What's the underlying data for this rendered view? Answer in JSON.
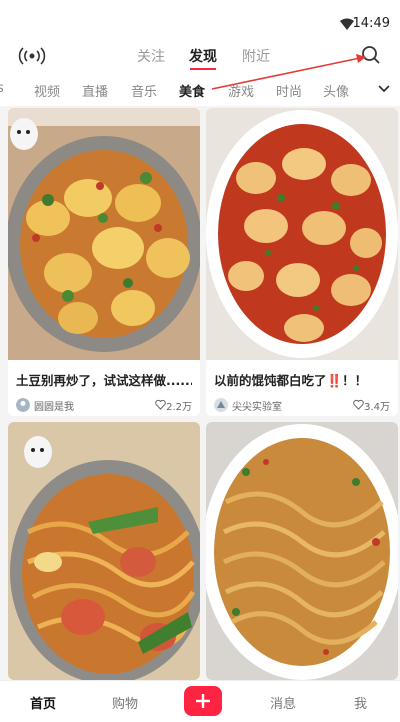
{
  "status_bar": {
    "time": "14:49",
    "wifi_icon": "wifi-icon"
  },
  "top_nav": {
    "live_icon": "live-broadcast-icon",
    "tabs": [
      {
        "label": "关注"
      },
      {
        "label": "发现"
      },
      {
        "label": "附近"
      }
    ],
    "active_tab": "发现",
    "search_icon": "search-icon"
  },
  "categories": {
    "items": [
      {
        "label": "视频"
      },
      {
        "label": "直播"
      },
      {
        "label": "音乐"
      },
      {
        "label": "美食"
      },
      {
        "label": "游戏"
      },
      {
        "label": "时尚"
      },
      {
        "label": "头像"
      }
    ],
    "active": "美食",
    "more_icon": "chevron-down-icon"
  },
  "feed": {
    "cards": [
      {
        "title": "土豆别再炒了，试试这样做......",
        "author": "圆圆是我",
        "likes": "2.2万",
        "image": "potato-dish-photo"
      },
      {
        "title": "以前的馄饨都白吃了‼️！！",
        "author": "尖尖实验室",
        "likes": "3.4万",
        "image": "wonton-dish-photo"
      },
      {
        "image": "noodle-stirfry-photo"
      },
      {
        "image": "noodle-chili-photo"
      }
    ]
  },
  "tab_bar": {
    "items": [
      {
        "label": "首页"
      },
      {
        "label": "购物"
      },
      {
        "label": "消息"
      },
      {
        "label": "我"
      }
    ],
    "active": "首页",
    "post_icon": "plus-icon"
  },
  "colors": {
    "accent": "#ff2442",
    "arrow": "#e53935"
  }
}
